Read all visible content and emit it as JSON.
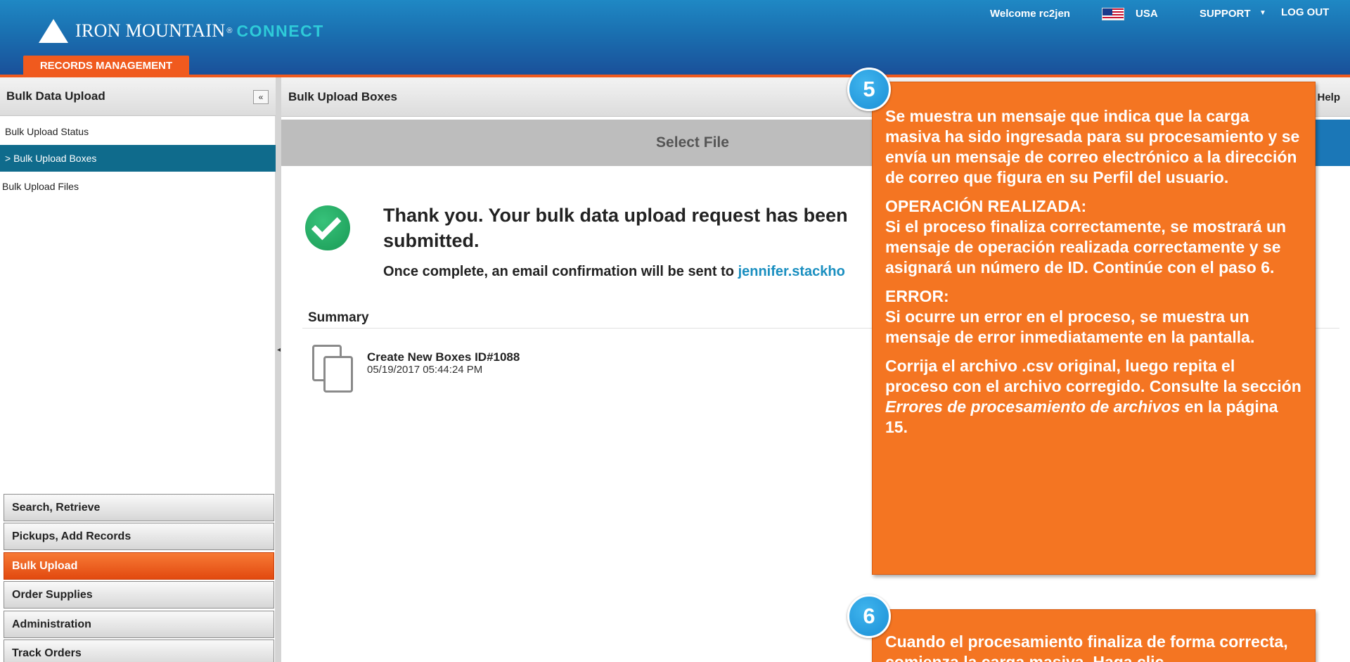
{
  "header": {
    "logo_iron": "IRON MOUNTAIN",
    "logo_reg": "®",
    "logo_connect": "CONNECT",
    "records_tab": "RECORDS MANAGEMENT",
    "welcome": "Welcome rc2jen",
    "country": "USA",
    "support": "SUPPORT",
    "support_caret": "▼",
    "logout": "LOG OUT"
  },
  "sidebar": {
    "title": "Bulk Data Upload",
    "collapse_glyph": "«",
    "links": {
      "status": "Bulk Upload Status",
      "boxes": "> Bulk Upload Boxes",
      "files": "Bulk Upload Files"
    },
    "bottom_items": {
      "search": "Search, Retrieve",
      "pickups": "Pickups, Add Records",
      "bulk": "Bulk Upload",
      "supplies": "Order Supplies",
      "admin": "Administration",
      "orders": "Track Orders"
    }
  },
  "main": {
    "title": "Bulk Upload Boxes",
    "help": "Help",
    "step_1": "Select File",
    "thank_you": "Thank you. Your bulk data upload request has been submitted.",
    "confirm_prefix": "Once complete, an email confirmation will be sent to ",
    "confirm_email": "jennifer.stackho",
    "summary_label": "Summary",
    "summary_item": {
      "name": "Create New Boxes ID#1088",
      "date": "05/19/2017 05:44:24 PM"
    }
  },
  "callouts": {
    "five": {
      "badge": "5",
      "p1": "Se muestra un mensaje que indica que la carga masiva ha sido ingresada para su procesamiento y se envía un mensaje de correo electrónico a la dirección de correo que figura en su Perfil del usuario.",
      "ok_head": "OPERACIÓN REALIZADA:",
      "ok_body": "Si el proceso finaliza correctamente, se mostrará un mensaje de operación realizada correctamente y se asignará un número de ID. Continúe con el paso 6.",
      "err_head": "ERROR:",
      "err_body": "Si ocurre un error en el proceso, se muestra un mensaje de error inmediatamente en la pantalla.",
      "fix_1": "Corrija el archivo .csv original, luego repita el proceso con el archivo corregido. Consulte la sección ",
      "fix_em": "Errores de procesamiento de archivos",
      "fix_2": " en la página 15."
    },
    "six": {
      "badge": "6",
      "p1": "Cuando el procesamiento finaliza de forma correcta, comienza la carga masiva. Haga clic"
    }
  },
  "colors": {
    "header_blue": "#1a6fb0",
    "accent_orange": "#f05a1e",
    "active_teal": "#0f6b8c",
    "callout_orange": "#f47522",
    "badge_blue": "#1a8fd6",
    "link_blue": "#1a8fc0",
    "success_green": "#1a9a55"
  },
  "icons": {
    "logo": "triangle-mountain-icon",
    "flag": "usa-flag-icon",
    "collapse": "double-chevron-left-icon",
    "success": "check-circle-icon",
    "summary": "copy-icon"
  }
}
